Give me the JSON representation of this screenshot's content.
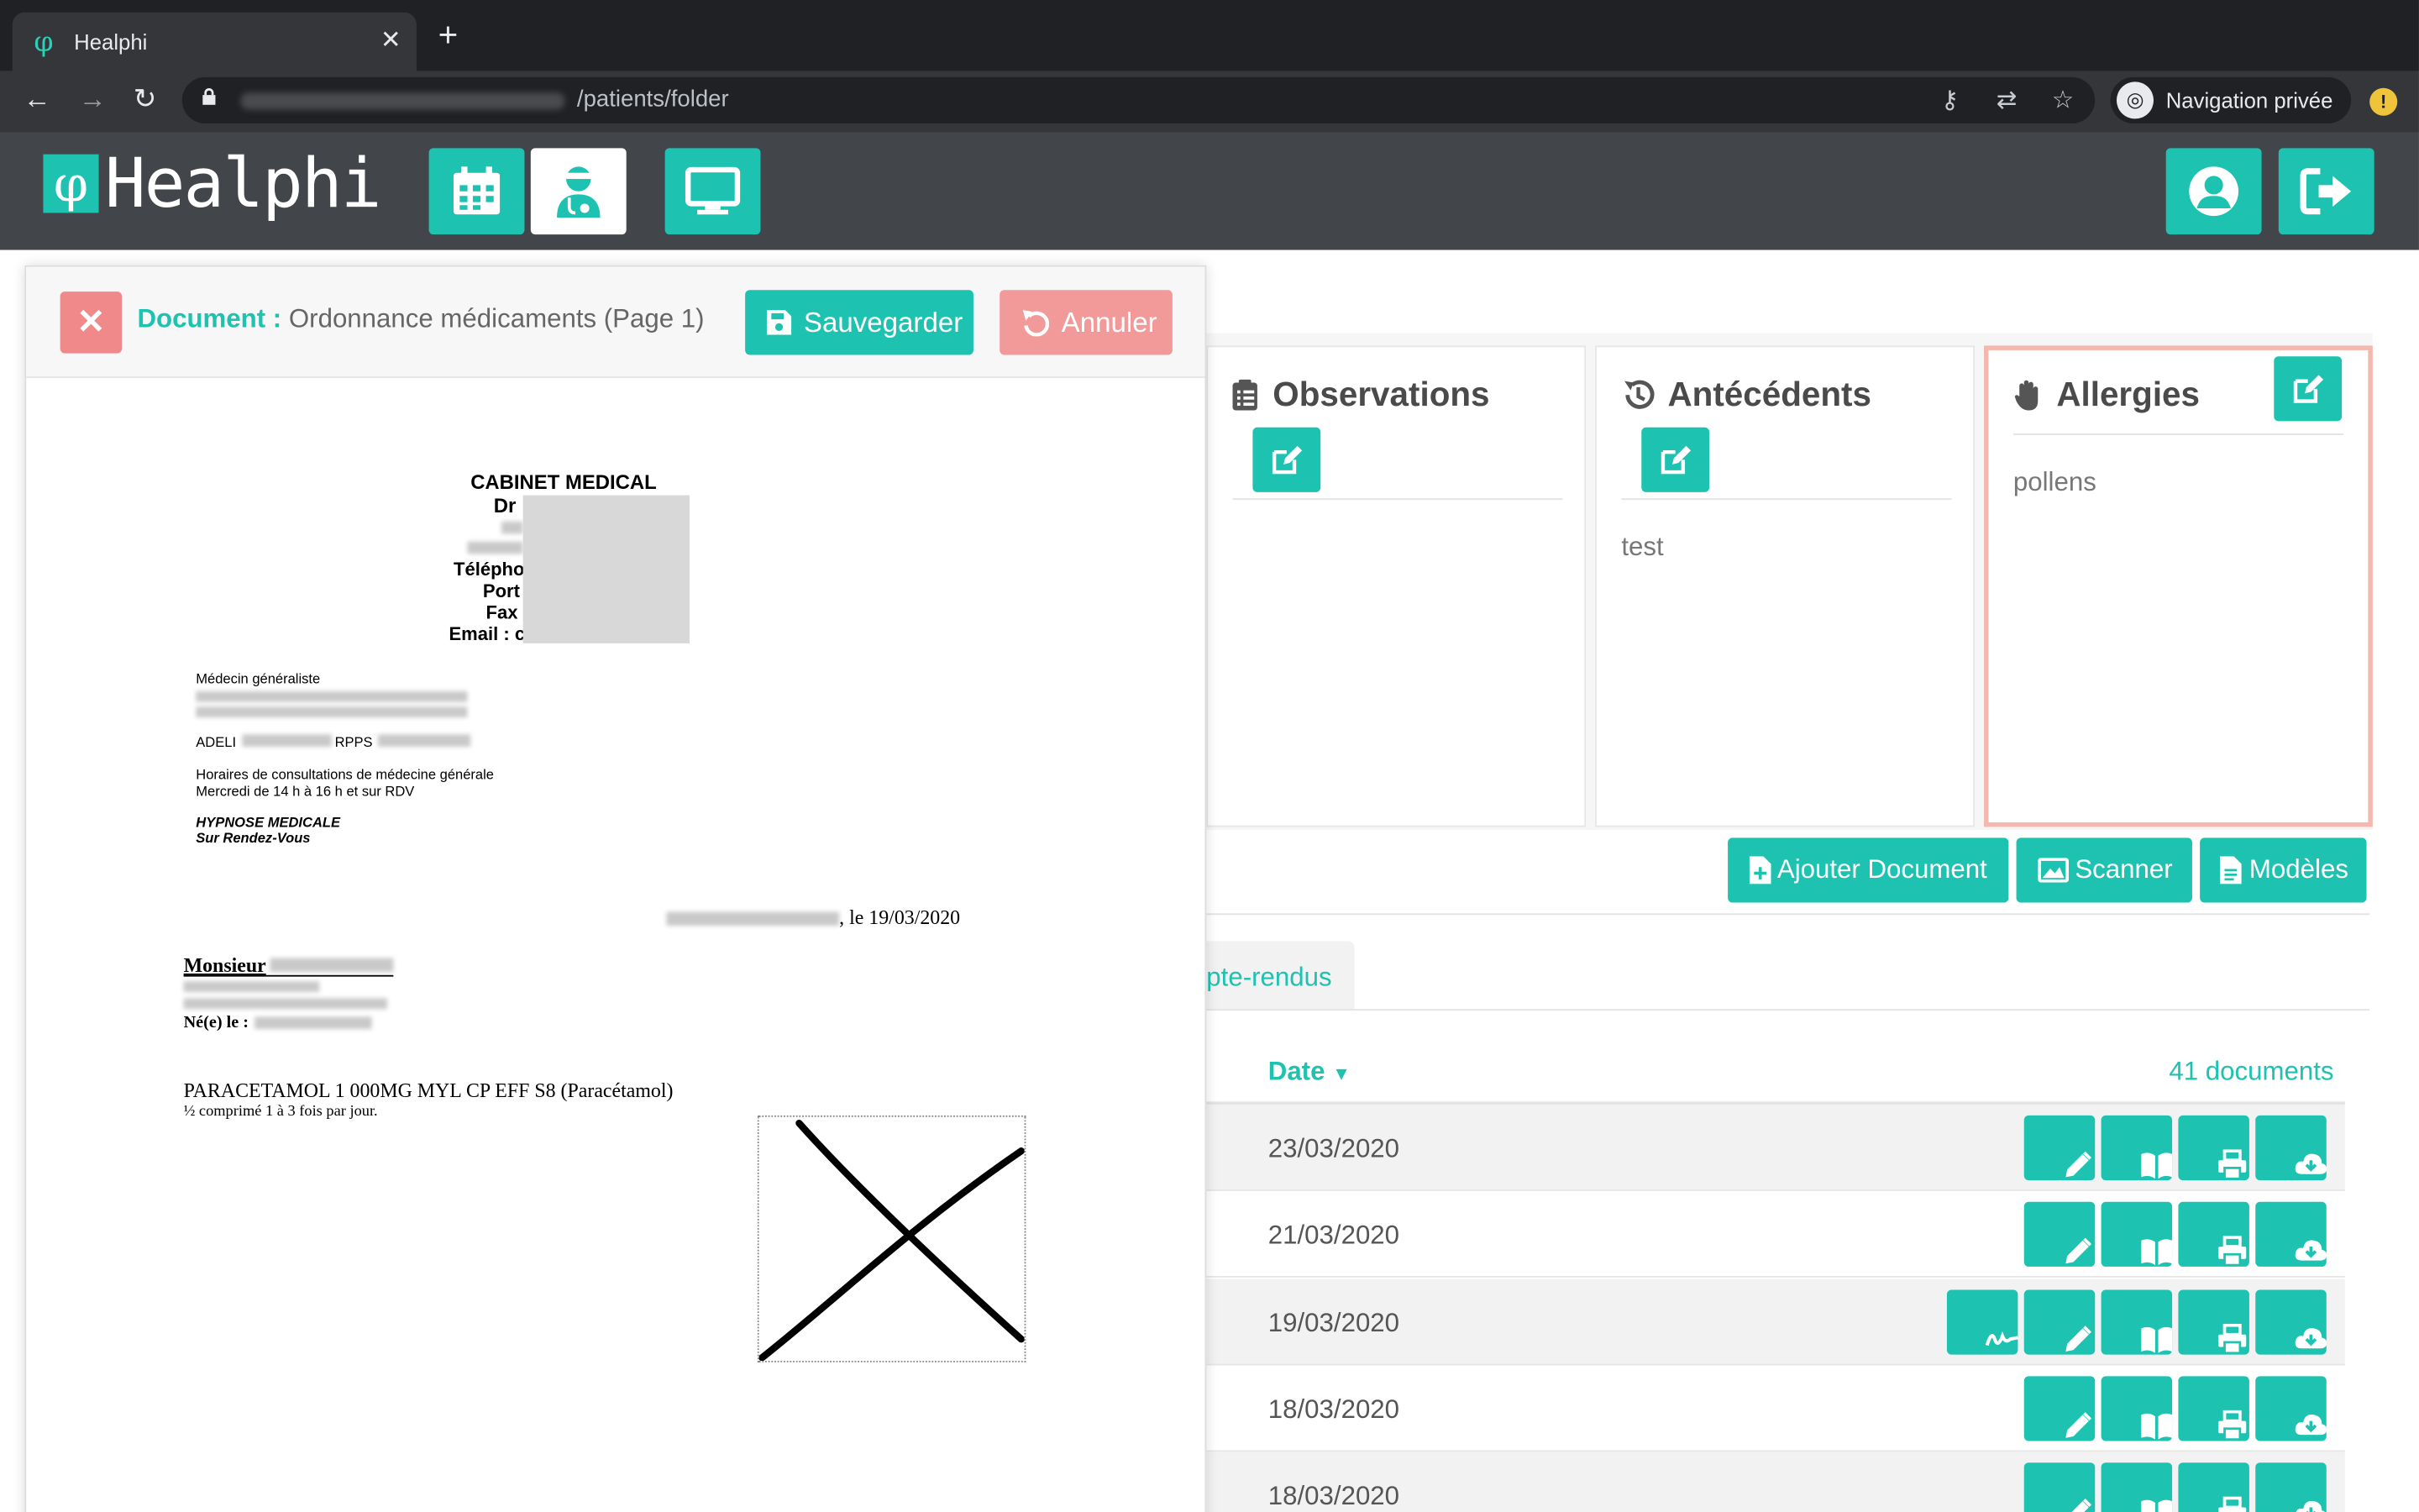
{
  "browser": {
    "tab_title": "Healphi",
    "tab_close": "✕",
    "new_tab": "+",
    "url_path": "/patients/folder",
    "incognito_label": "Navigation privée"
  },
  "header": {
    "logo_symbol": "φ",
    "logo_text": "Healphi",
    "nav_icons": [
      "calendar-icon",
      "patient-icon",
      "monitor-icon"
    ],
    "right_icons": [
      "user-icon",
      "logout-icon"
    ]
  },
  "cards": {
    "observations": {
      "title": "Observations",
      "content": ""
    },
    "antecedents": {
      "title": "Antécédents",
      "content": "test"
    },
    "allergies": {
      "title": "Allergies",
      "content": "pollens"
    }
  },
  "actions": {
    "add_document": "Ajouter Document",
    "scanner": "Scanner",
    "templates": "Modèles"
  },
  "tabs": {
    "visible_tab": "pte-rendus"
  },
  "documents": {
    "date_header": "Date",
    "count_label": "41 documents",
    "rows": [
      {
        "date": "23/03/2020",
        "signed": false
      },
      {
        "date": "21/03/2020",
        "signed": false
      },
      {
        "date": "19/03/2020",
        "signed": true
      },
      {
        "date": "18/03/2020",
        "signed": false
      },
      {
        "date": "18/03/2020",
        "signed": false
      }
    ]
  },
  "modal": {
    "title_key": "Document :",
    "title_value": "Ordonnance médicaments (Page 1)",
    "save_label": "Sauvegarder",
    "cancel_label": "Annuler",
    "close_label": "✕"
  },
  "document": {
    "cabinet": "CABINET MEDICAL",
    "dr": "Dr",
    "phone": "Télépho",
    "port": "Port",
    "fax": "Fax",
    "email": "Email : c",
    "specialty": "Médecin généraliste",
    "adeli": "ADELI",
    "rpps": "RPPS",
    "hours_title": "Horaires de consultations de médecine générale",
    "hours": "Mercredi de 14 h à 16 h et sur RDV",
    "hypnose": "HYPNOSE MEDICALE",
    "rdv": "Sur Rendez-Vous",
    "date_line": ", le 19/03/2020",
    "patient_title": "Monsieur",
    "born": "Né(e) le :",
    "medication": "PARACETAMOL 1 000MG MYL CP EFF S8 (Paracétamol)",
    "dosage": "½ comprimé 1 à 3 fois par jour."
  },
  "colors": {
    "accent": "#1ec2b0",
    "danger": "#f08a8a",
    "header_bg": "#424549"
  }
}
